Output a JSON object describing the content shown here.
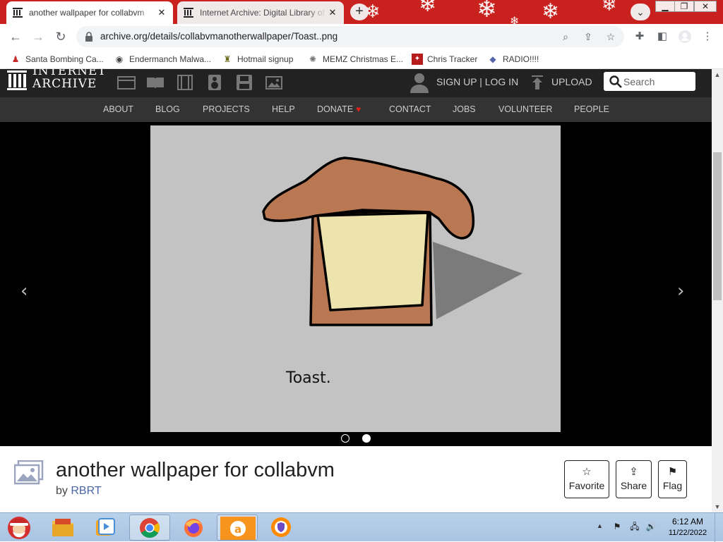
{
  "browser": {
    "tabs": [
      {
        "title": "another wallpaper for collabvm",
        "favicon": "archive-icon",
        "active": true
      },
      {
        "title": "Internet Archive: Digital Library of Free & Borrowable Books",
        "favicon": "archive-icon",
        "active": false
      }
    ],
    "url": "archive.org/details/collabvmanotherwallpaper/Toast..png",
    "bookmarks": [
      {
        "label": "Santa Bombing Ca...",
        "icon": "santa-icon"
      },
      {
        "label": "Endermanch Malwa...",
        "icon": "raccoon-icon"
      },
      {
        "label": "Hotmail signup",
        "icon": "people-icon"
      },
      {
        "label": "MEMZ Christmas E...",
        "icon": "nyan-icon"
      },
      {
        "label": "Chris Tracker",
        "icon": "tracker-icon"
      },
      {
        "label": "RADIO!!!!",
        "icon": "radio-icon"
      }
    ]
  },
  "ia": {
    "logo_line1": "INTERNET",
    "logo_line2": "ARCHIVE",
    "signup": "SIGN UP | LOG IN",
    "upload": "UPLOAD",
    "search_placeholder": "Search",
    "nav": [
      "ABOUT",
      "BLOG",
      "PROJECTS",
      "HELP",
      "DONATE",
      "CONTACT",
      "JOBS",
      "VOLUNTEER",
      "PEOPLE"
    ]
  },
  "viewer": {
    "caption": "Toast.",
    "prev_arrow": "‹",
    "next_arrow": "›",
    "slide_count": 2,
    "current_slide": 2
  },
  "item": {
    "title": "another wallpaper for collabvm",
    "by_prefix": "by",
    "author": "RBRT",
    "actions": [
      {
        "label": "Favorite",
        "icon": "star-icon"
      },
      {
        "label": "Share",
        "icon": "share-icon"
      },
      {
        "label": "Flag",
        "icon": "flag-icon"
      }
    ]
  },
  "taskbar": {
    "time": "6:12 AM",
    "date": "11/22/2022",
    "apps": [
      "file-explorer",
      "media-player",
      "chrome",
      "firefox",
      "avast-secure-browser",
      "avast-antivirus"
    ]
  },
  "colors": {
    "tabstrip": "#c9221e",
    "ia_header": "#222222",
    "ia_nav": "#333333",
    "link": "#4b64a6",
    "heart": "#e0201c",
    "toast_crust": "#b97851",
    "toast_bread": "#ede4ad",
    "shadow": "#7b7b7b"
  }
}
